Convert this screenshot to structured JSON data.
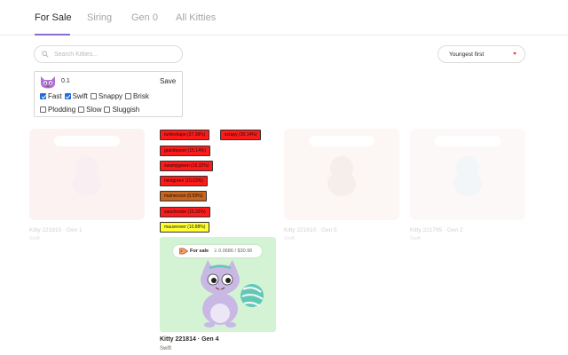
{
  "tabs": [
    {
      "label": "For Sale",
      "active": true
    },
    {
      "label": "Siring",
      "active": false
    },
    {
      "label": "Gen 0",
      "active": false
    },
    {
      "label": "All Kitties",
      "active": false
    }
  ],
  "search": {
    "placeholder": "Search Kitties...",
    "value": "",
    "icon": "search-icon"
  },
  "sort": {
    "selected": "Youngest first",
    "icon": "chevron-down-icon",
    "accent": "#e4404a"
  },
  "filter": {
    "logo_icon": "cat-face-icon",
    "logo_color": "#b26fd6",
    "price": "0.1",
    "save_label": "Save",
    "row1": [
      {
        "label": "Fast",
        "checked": true
      },
      {
        "label": "Swift",
        "checked": true
      },
      {
        "label": "Snappy",
        "checked": false
      },
      {
        "label": "Brisk",
        "checked": false
      }
    ],
    "row2": [
      {
        "label": "Plodding",
        "checked": false
      },
      {
        "label": "Slow",
        "checked": false
      },
      {
        "label": "Sluggish",
        "checked": false
      }
    ]
  },
  "gene_tags": [
    {
      "text": "turtleshape (27.39%)",
      "color": "#ff1a1a"
    },
    {
      "text": "scrapy (30.14%)",
      "color": "#ff1a1a"
    },
    {
      "text": "granitepeer (15.14%)",
      "color": "#ff1a1a"
    },
    {
      "text": "swampgreen (16.32%)",
      "color": "#ff1a1a"
    },
    {
      "text": "mintgreen (15.53%)",
      "color": "#ff1a1a"
    },
    {
      "text": "mainecoon (0.59%)",
      "color": "#c8641e"
    },
    {
      "text": "sauchessie (16.33%)",
      "color": "#ff1a1a"
    },
    {
      "text": "mauveover (10.88%)",
      "color": "#ffff33"
    }
  ],
  "background_cards": [
    {
      "title": "Kitty 221815 · Gen 1",
      "sub": "Swift",
      "bg": "#f6c7c7"
    },
    {
      "title": "Kitty 221810 · Gen 5",
      "sub": "Swift",
      "bg": "#f3d9cf"
    },
    {
      "title": "Kitty 221795 · Gen 2",
      "sub": "Swift",
      "bg": "#f6e0e0"
    }
  ],
  "main_card": {
    "bg": "#d3f3d4",
    "sale_label": "For sale",
    "sale_price": "Ξ 0.0686 / $30.96",
    "title": "Kitty 221814 · Gen 4",
    "sub": "Swift"
  },
  "accent": "#8a6bd1"
}
